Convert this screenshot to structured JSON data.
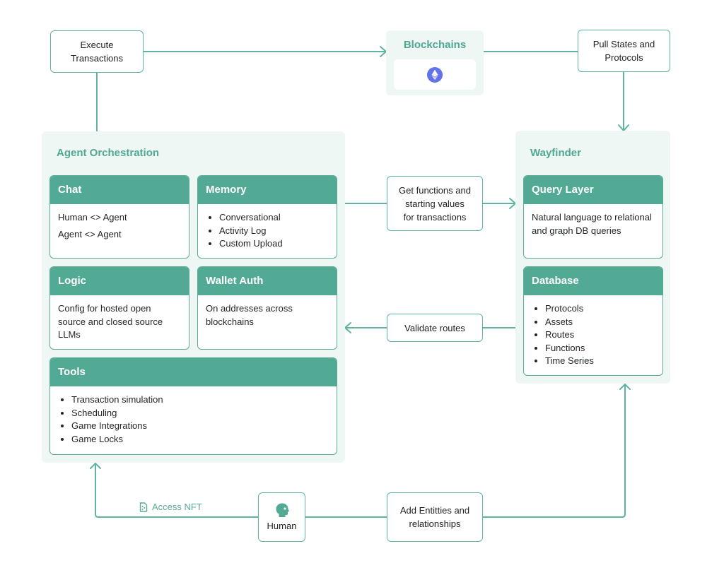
{
  "colors": {
    "accent": "#52aa94",
    "wire": "#5fb3a0",
    "group_bg": "#eef7f4",
    "ethereum": "#6272ea"
  },
  "nodes": {
    "execute_transactions": "Execute\nTransactions",
    "pull_states": "Pull States and\nProtocols",
    "get_functions": "Get functions and\nstarting values\nfor transactions",
    "validate_routes": "Validate routes",
    "human": "Human",
    "add_entities": "Add Entitties and\nrelationships"
  },
  "blockchains": {
    "title": "Blockchains",
    "icon": "ethereum-icon"
  },
  "agent_orchestration": {
    "title": "Agent Orchestration",
    "cards": {
      "chat": {
        "title": "Chat",
        "lines": [
          "Human <> Agent",
          "Agent <> Agent"
        ]
      },
      "memory": {
        "title": "Memory",
        "items": [
          "Conversational",
          "Activity Log",
          "Custom Upload"
        ]
      },
      "logic": {
        "title": "Logic",
        "text": "Config for hosted open source and closed source LLMs"
      },
      "wallet_auth": {
        "title": "Wallet Auth",
        "text": "On addresses across blockchains"
      },
      "tools": {
        "title": "Tools",
        "items": [
          "Transaction simulation",
          "Scheduling",
          "Game Integrations",
          "Game Locks"
        ]
      }
    }
  },
  "wayfinder": {
    "title": "Wayfinder",
    "cards": {
      "query_layer": {
        "title": "Query Layer",
        "text": "Natural language to relational and graph DB queries"
      },
      "database": {
        "title": "Database",
        "items": [
          "Protocols",
          "Assets",
          "Routes",
          "Functions",
          "Time Series"
        ]
      }
    }
  },
  "edge_labels": {
    "access_nft": "Access NFT",
    "access_nft_icon": "nft-file-icon"
  }
}
